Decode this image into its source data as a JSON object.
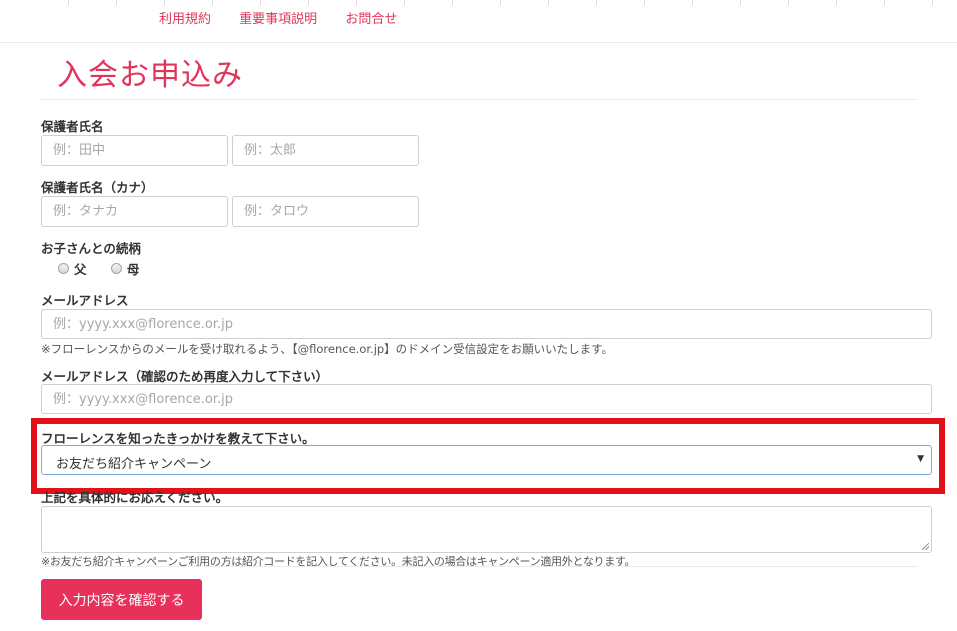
{
  "nav": {
    "links": [
      "利用規約",
      "重要事項説明",
      "お問合せ"
    ]
  },
  "page": {
    "title": "入会お申込み"
  },
  "form": {
    "guardian_name": {
      "label": "保護者氏名",
      "last_placeholder": "例：田中",
      "first_placeholder": "例：太郎"
    },
    "guardian_kana": {
      "label": "保護者氏名（カナ）",
      "last_placeholder": "例：タナカ",
      "first_placeholder": "例：タロウ"
    },
    "relationship": {
      "label": "お子さんとの続柄",
      "options": [
        "父",
        "母"
      ]
    },
    "email": {
      "label": "メールアドレス",
      "placeholder": "例：yyyy.xxx@florence.or.jp",
      "note": "※フローレンスからのメールを受け取れるよう、【@florence.or.jp】のドメイン受信設定をお願いいたします。"
    },
    "email_confirm": {
      "label": "メールアドレス（確認のため再度入力して下さい）",
      "placeholder": "例：yyyy.xxx@florence.or.jp"
    },
    "referral": {
      "label": "フローレンスを知ったきっかけを教えて下さい。",
      "selected": "お友だち紹介キャンペーン"
    },
    "details": {
      "label": "上記を具体的にお応えください。",
      "note": "※お友だち紹介キャンペーンご利用の方は紹介コードを記入してください。未記入の場合はキャンペーン適用外となります。"
    },
    "submit_label": "入力内容を確認する"
  },
  "colors": {
    "accent": "#e0355a",
    "button": "#e8315a",
    "highlight": "#e3101a",
    "select_border": "#7aaee0"
  }
}
